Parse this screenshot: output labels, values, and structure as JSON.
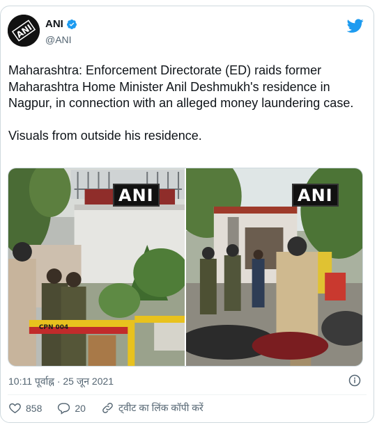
{
  "user": {
    "name": "ANI",
    "handle": "@ANI",
    "avatar_text": "ANI"
  },
  "tweet": {
    "paragraph_1": "Maharashtra: Enforcement Directorate (ED) raids former Maharashtra Home Minister Anil Deshmukh's residence in Nagpur, in connection with an alleged money laundering case.",
    "paragraph_2": "Visuals from outside his residence."
  },
  "media": {
    "left_watermark": "ANI",
    "right_watermark": "ANI",
    "barrier_sign": "CPN 004"
  },
  "meta": {
    "timestamp": "10:11 पूर्वाह्न · 25 जून 2021"
  },
  "actions": {
    "like_count": "858",
    "reply_count": "20",
    "copy_link_label": "ट्वीट का लिंक कॉपी करें"
  },
  "colors": {
    "twitter_blue": "#1d9bf0",
    "like_red": "#f91880",
    "secondary_text": "#536471"
  },
  "icons": {
    "verified": "verified-badge-icon",
    "bird": "twitter-bird-icon",
    "info": "info-icon",
    "like": "heart-icon",
    "reply": "speech-bubble-icon",
    "link": "link-icon"
  }
}
